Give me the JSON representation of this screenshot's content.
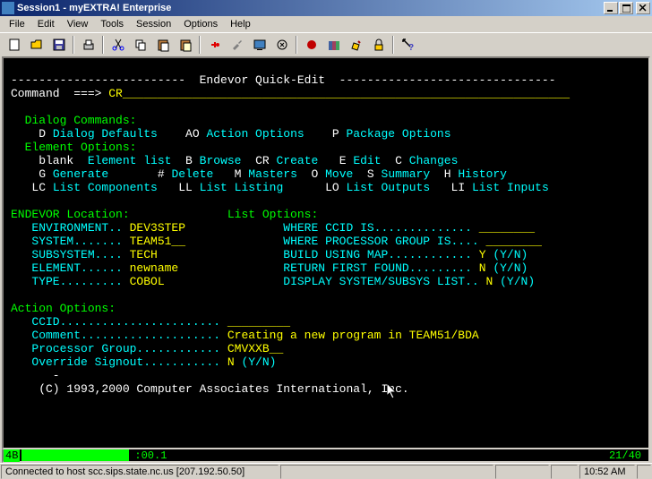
{
  "titlebar": {
    "text": "Session1 - myEXTRA! Enterprise"
  },
  "menu": {
    "file": "File",
    "edit": "Edit",
    "view": "View",
    "tools": "Tools",
    "session": "Session",
    "options": "Options",
    "help": "Help"
  },
  "term": {
    "header": "-------------------------  Endevor Quick-Edit  -------------------------------",
    "cmd_prompt": "Command  ===> ",
    "cmd_value": "CR",
    "cmd_fill": "________________________________________________________________",
    "dc_heading": "  Dialog Commands:",
    "dc_d_k": "    D ",
    "dc_d_v": "Dialog Defaults",
    "dc_ao_k": "    AO ",
    "dc_ao_v": "Action Options",
    "dc_p_k": "    P ",
    "dc_p_v": "Package Options",
    "eo_heading": "  Element Options:",
    "eo_bl_k": "    blank  ",
    "eo_bl_v": "Element list",
    "eo_b_k": "  B ",
    "eo_b_v": "Browse",
    "eo_cr_k": "  CR ",
    "eo_cr_v": "Create",
    "eo_e_k": "   E ",
    "eo_e_v": "Edit",
    "eo_c_k": "  C ",
    "eo_c_v": "Changes",
    "eo_g_k": "    G ",
    "eo_g_v": "Generate",
    "eo_hs_k": "       # ",
    "eo_hs_v": "Delete",
    "eo_m_k": "   M ",
    "eo_m_v": "Masters",
    "eo_o_k": "  O ",
    "eo_o_v": "Move",
    "eo_s_k": "  S ",
    "eo_s_v": "Summary",
    "eo_h_k": "  H ",
    "eo_h_v": "History",
    "eo_lc_k": "   LC ",
    "eo_lc_v": "List Components",
    "eo_ll_k": "   LL ",
    "eo_ll_v": "List Listing",
    "eo_lo_k": "      LO ",
    "eo_lo_v": "List Outputs",
    "eo_li_k": "   LI ",
    "eo_li_v": "List Inputs",
    "loc_heading": "ENDEVOR Location:",
    "listopt_heading": "              List Options:",
    "env_l": "   ENVIRONMENT.. ",
    "env_v": "DEV3STEP",
    "env_r": "              WHERE CCID IS.............. ",
    "env_rf": "________",
    "sys_l": "   SYSTEM....... ",
    "sys_v": "TEAM51__",
    "sys_r": "              WHERE PROCESSOR GROUP IS.... ",
    "sys_rf": "________",
    "sub_l": "   SUBSYSTEM.... ",
    "sub_v": "TECH",
    "sub_pad": "    ",
    "sub_r": "              BUILD USING MAP............ ",
    "sub_rv": "Y ",
    "sub_yn": "(Y/N)",
    "ele_l": "   ELEMENT...... ",
    "ele_v": "newname",
    "ele_pad": " ",
    "ele_r": "              RETURN FIRST FOUND......... ",
    "ele_rv": "N ",
    "ele_yn": "(Y/N)",
    "typ_l": "   TYPE......... ",
    "typ_v": "COBOL",
    "typ_pad": "   ",
    "typ_r": "              DISPLAY SYSTEM/SUBSYS LIST.. ",
    "typ_rv": "N ",
    "typ_yn": "(Y/N)",
    "ao_heading": "Action Options:",
    "ccid_l": "   CCID....................... ",
    "ccid_v": "_________",
    "cmt_l": "   Comment.................... ",
    "cmt_v": "Creating a new program in TEAM51/BDA",
    "pg_l": "   Processor Group............ ",
    "pg_v": "CMVXXB__",
    "os_l": "   Override Signout........... ",
    "os_v": "N ",
    "os_yn": "(Y/N)",
    "dash": "      -",
    "copyright": "    (C) 1993,2000 Computer Associates International, Inc."
  },
  "termstatus": {
    "mode": "4B",
    "clock": ":00.1",
    "pos": "21/40"
  },
  "status": {
    "conn": "Connected to host scc.sips.state.nc.us [207.192.50.50]",
    "time": "10:52 AM"
  }
}
